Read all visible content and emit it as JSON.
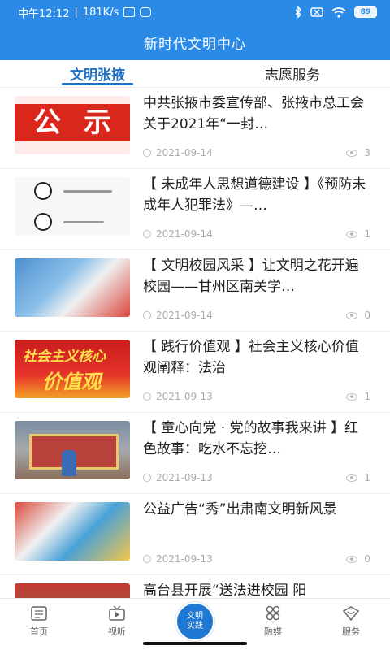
{
  "statusbar": {
    "time": "中午12:12",
    "speed": "181K/s",
    "battery": "89"
  },
  "header": {
    "title": "新时代文明中心"
  },
  "tabs": [
    {
      "label": "文明张掖",
      "active": true
    },
    {
      "label": "志愿服务",
      "active": false
    }
  ],
  "feed": [
    {
      "title": "中共张掖市委宣传部、张掖市总工会关于2021年“一封…",
      "date": "2021-09-14",
      "views": "3",
      "thumb_text": [
        "公",
        "示"
      ]
    },
    {
      "title": "【 未成年人思想道德建设 】《预防未成年人犯罪法》—…",
      "date": "2021-09-14",
      "views": "1"
    },
    {
      "title": "【 文明校园风采 】让文明之花开遍校园——甘州区南关学…",
      "date": "2021-09-14",
      "views": "0"
    },
    {
      "title": "【 践行价值观 】社会主义核心价值观阐释：法治",
      "date": "2021-09-13",
      "views": "1",
      "thumb_text": [
        "社会主义核心",
        "价值观"
      ]
    },
    {
      "title": "【 童心向党 · 党的故事我来讲 】红色故事：吃水不忘挖…",
      "date": "2021-09-13",
      "views": "1"
    },
    {
      "title": "公益广告“秀”出肃南文明新风景",
      "date": "2021-09-13",
      "views": "0"
    },
    {
      "title": "高台县开展“送法进校园 阳",
      "date": "",
      "views": ""
    }
  ],
  "bottomnav": {
    "items": [
      {
        "label": "首页",
        "icon": "home-icon"
      },
      {
        "label": "视听",
        "icon": "video-icon"
      },
      {
        "label": "文明实践",
        "icon": "center-badge"
      },
      {
        "label": "融媒",
        "icon": "media-icon"
      },
      {
        "label": "服务",
        "icon": "service-icon"
      }
    ],
    "center_line1": "文明",
    "center_line2": "实践"
  },
  "colors": {
    "primary": "#2b8ae6",
    "active_tab": "#1f6fc4",
    "accent_red": "#d9271c"
  }
}
